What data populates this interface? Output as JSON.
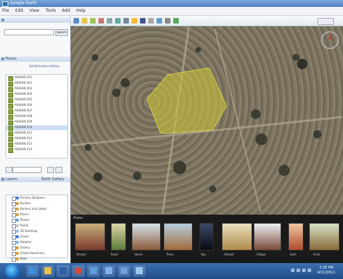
{
  "window": {
    "title": "Google Earth"
  },
  "menu": [
    "File",
    "Edit",
    "View",
    "Tools",
    "Add",
    "Help"
  ],
  "search": {
    "button_label": "Search",
    "links": "Get Directions History"
  },
  "panels": {
    "places": "Places",
    "layers": "Layers",
    "earth_gallery": "Earth Gallery"
  },
  "places": {
    "items": [
      "ARAKAN 001",
      "ARAKAN 002",
      "ARAKAN 003",
      "ARAKAN 004",
      "ARAKAN 005",
      "ARAKAN 006",
      "ARAKAN 007",
      "ARAKAN 008",
      "ARAKAN 009",
      "ARAKAN 010",
      "ARAKAN 011",
      "ARAKAN 012",
      "ARAKAN 013",
      "ARAKAN 014"
    ],
    "selected_index": 9
  },
  "layers": {
    "items": [
      "Primary Database",
      "Borders",
      "Borders and Labels",
      "Places",
      "Photos",
      "Roads",
      "3D Buildings",
      "Ocean",
      "Weather",
      "Gallery",
      "Global Awareness",
      "More"
    ]
  },
  "photos": {
    "header": "Photos",
    "captions": [
      "Shanty",
      "Road",
      "Home",
      "Trees",
      "Sky",
      "Market",
      "Village",
      "Gate",
      "Field"
    ]
  },
  "taskbar": {
    "time": "1:25 PM",
    "date": "4/11/2011"
  }
}
